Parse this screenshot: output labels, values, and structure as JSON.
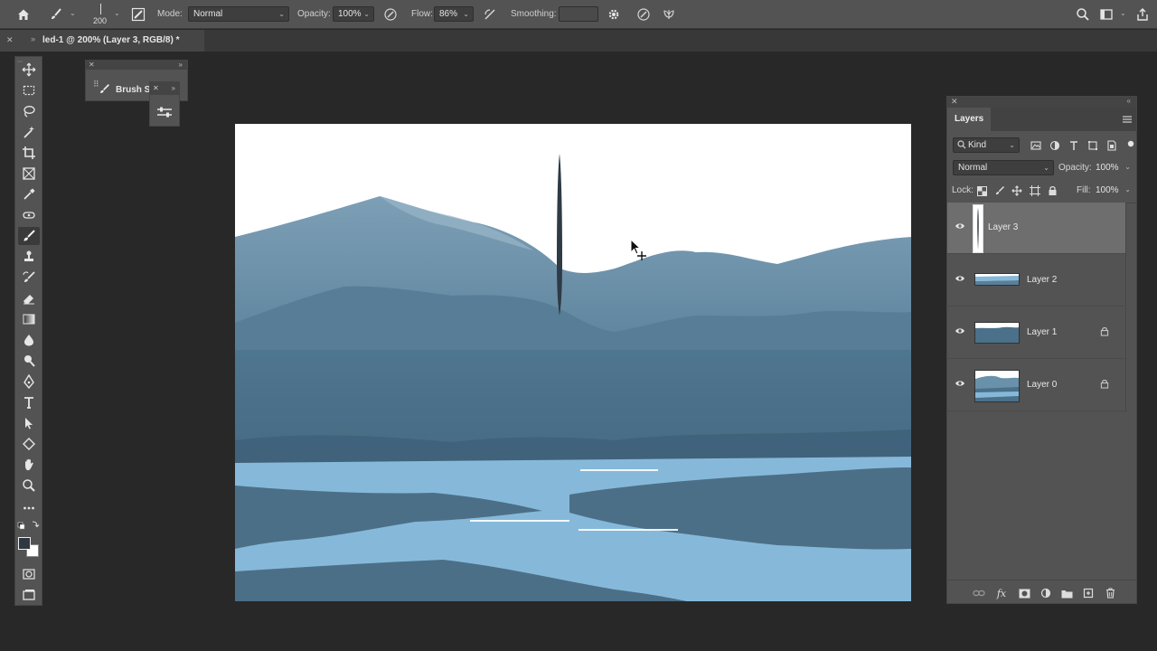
{
  "options_bar": {
    "brush_size": "200",
    "mode_label": "Mode:",
    "mode_value": "Normal",
    "opacity_label": "Opacity:",
    "opacity_value": "100%",
    "flow_label": "Flow:",
    "flow_value": "86%",
    "smoothing_label": "Smoothing:",
    "smoothing_value": ""
  },
  "document_tab": {
    "title": "led-1 @ 200% (Layer 3, RGB/8) *"
  },
  "brush_settings_panel": {
    "label": "Brush Settings"
  },
  "toolbar": {
    "active_tool": "brush-tool"
  },
  "layers_panel": {
    "tab_label": "Layers",
    "filter_kind": "Kind",
    "blend_mode": "Normal",
    "opacity_label": "Opacity:",
    "opacity_value": "100%",
    "lock_label": "Lock:",
    "fill_label": "Fill:",
    "fill_value": "100%",
    "layers": [
      {
        "name": "Layer 3",
        "visible": true,
        "locked": false,
        "selected": true
      },
      {
        "name": "Layer 2",
        "visible": true,
        "locked": false,
        "selected": false
      },
      {
        "name": "Layer 1",
        "visible": true,
        "locked": true,
        "selected": false
      },
      {
        "name": "Layer 0",
        "visible": true,
        "locked": true,
        "selected": false
      }
    ]
  },
  "colors": {
    "sky": "#ffffff",
    "far_mountains": "#6a91aa",
    "mid_mountains": "#5a8099",
    "near_land": "#4a6f87",
    "water": "#86b9d9",
    "stroke": "#2e3a44",
    "ui_panel": "#535353",
    "ui_dark": "#282828"
  }
}
